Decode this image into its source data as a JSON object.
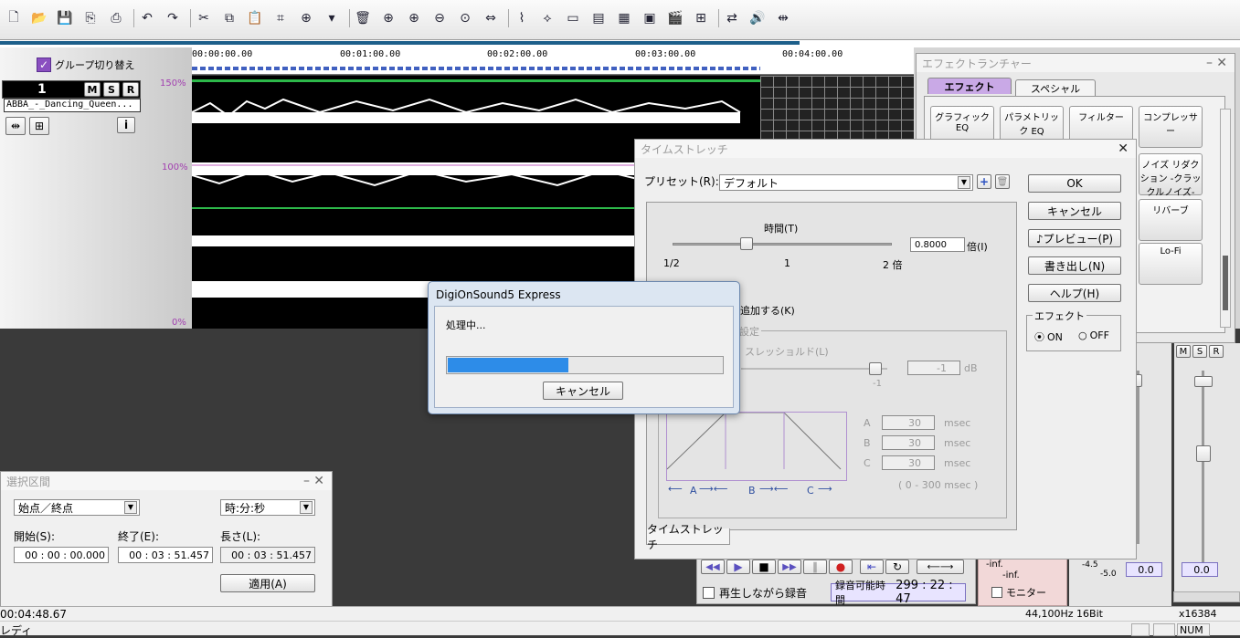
{
  "toolbar": {
    "icons": [
      "new-file-icon",
      "open-folder-icon",
      "save-icon",
      "save-as-icon",
      "export-icon",
      "undo-icon",
      "redo-icon",
      "cut-icon",
      "copy-icon",
      "paste-icon",
      "crop-icon",
      "insert-icon",
      "dropdown-arrow-icon",
      "delete-icon",
      "zoom-in-icon",
      "zoom-in-v-icon",
      "zoom-out-icon",
      "zoom-fit-icon",
      "fit-width-icon",
      "snap-icon",
      "marker-icon",
      "view1-icon",
      "view2-icon",
      "view3-icon",
      "view4-icon",
      "clapper-icon",
      "view5-icon",
      "convert-icon",
      "speaker-icon",
      "split-icon"
    ]
  },
  "track": {
    "group_toggle": "グループ切り替え",
    "number": "1",
    "m": "M",
    "s": "S",
    "r": "R",
    "clip_name": "ABBA_-_Dancing_Queen...",
    "info": "i",
    "scale": [
      "150%",
      "100%",
      "0%"
    ]
  },
  "ruler": {
    "ticks": [
      "00:00:00.00",
      "00:01:00.00",
      "00:02:00.00",
      "00:03:00.00",
      "00:04:00.00"
    ]
  },
  "effect_launcher": {
    "title": "エフェクトランチャー",
    "tabs": [
      "エフェクト",
      "スペシャル"
    ],
    "buttons": [
      {
        "name": "graphic-eq-button",
        "label": "グラフィックEQ"
      },
      {
        "name": "parametric-eq-button",
        "label": "パラメトリック EQ"
      },
      {
        "name": "filter-button",
        "label": "フィルター"
      },
      {
        "name": "compressor-button",
        "label": "コンプレッサー"
      },
      {
        "name": "noise-reduction-button",
        "label": "ノイズ リダクション -クラックルノイズ-"
      },
      {
        "name": "reverb-button",
        "label": "リバーブ"
      },
      {
        "name": "lofi-button",
        "label": "Lo-Fi"
      }
    ]
  },
  "time_stretch": {
    "title": "タイムストレッチ",
    "preset_label": "プリセット(R):",
    "preset_value": "デフォルト",
    "ok": "OK",
    "cancel": "キャンセル",
    "preview": "♪プレビュー(P)",
    "export": "書き出し(N)",
    "help": "ヘルプ(H)",
    "time_label": "時間(T)",
    "ratio_value": "0.8000",
    "ratio_unit": "倍(I)",
    "slider_min": "1/2",
    "slider_mid": "1",
    "slider_max": "2 倍",
    "add_label": "追加する(K)",
    "setting_label": "設定",
    "threshold_label": "スレッショルド(L)",
    "threshold_value": "-1",
    "threshold_unit": "dB",
    "threshold_tick": "-1",
    "a_label": "A",
    "a_value": "30",
    "a_unit": "msec",
    "b_label": "B",
    "b_value": "30",
    "b_unit": "msec",
    "c_label": "C",
    "c_value": "30",
    "c_unit": "msec",
    "range_note": "( 0 - 300 msec )",
    "diagram_a": "A",
    "diagram_b": "B",
    "diagram_c": "C",
    "effect_group": "エフェクト",
    "on_label": "ON",
    "off_label": "OFF",
    "bottom_tab": "タイムストレッチ"
  },
  "progress_dialog": {
    "title": "DigiOnSound5 Express",
    "message": "処理中...",
    "progress": 0.44,
    "cancel": "キャンセル"
  },
  "selection": {
    "title": "選択区間",
    "mode_value": "始点／終点",
    "unit_value": "時:分:秒",
    "start_label": "開始(S):",
    "end_label": "終了(E):",
    "length_label": "長さ(L):",
    "start_value": "00 : 00 : 00.000",
    "end_value": "00 : 03 : 51.457",
    "length_value": "00 : 03 : 51.457",
    "apply": "適用(A)"
  },
  "transport": {
    "record_while_play": "再生しながら録音",
    "rec_time_label": "録音可能時間",
    "rec_time_value": "299 : 22 : 47",
    "monitor": "モニター",
    "inf1": "-inf.",
    "inf2": "-inf.",
    "level_a": "-4.5",
    "level_b": "-5.0",
    "level_val1": "0.0",
    "level_val2": "0.0",
    "mixer_m": "M",
    "mixer_s": "S",
    "mixer_r": "R"
  },
  "status": {
    "time": "00:04:48.67",
    "ready": "レディ",
    "format": "44,100Hz 16Bit",
    "zoom": "x16384",
    "num": "NUM"
  }
}
